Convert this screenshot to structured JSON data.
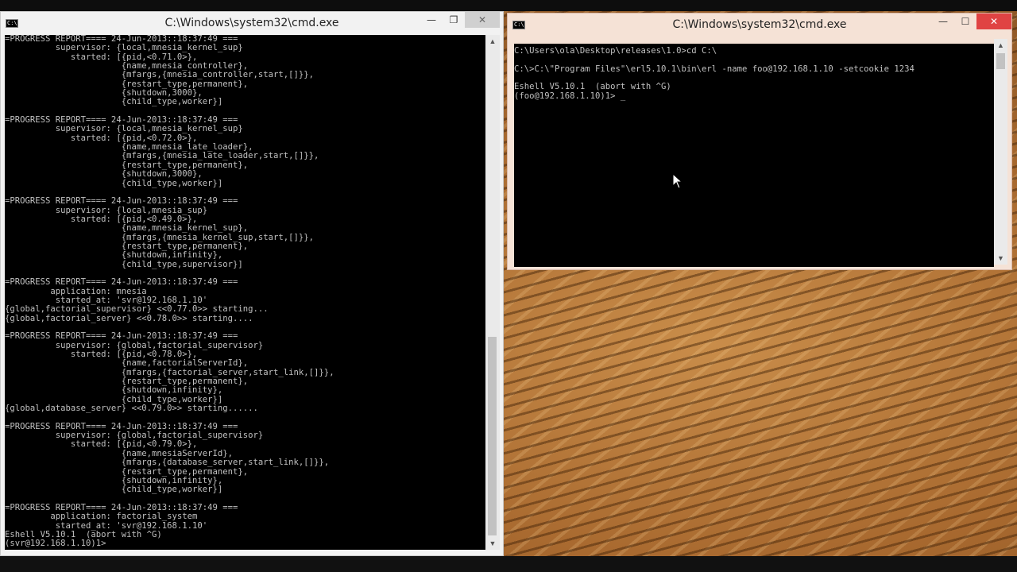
{
  "left_window": {
    "title": "C:\\Windows\\system32\\cmd.exe",
    "icon_label": "C:\\",
    "controls": {
      "minimize": "—",
      "maximize": "❐",
      "close": "✕"
    },
    "lines": [
      "=PROGRESS REPORT==== 24-Jun-2013::18:37:49 ===",
      "          supervisor: {local,mnesia_kernel_sup}",
      "             started: [{pid,<0.71.0>},",
      "                       {name,mnesia_controller},",
      "                       {mfargs,{mnesia_controller,start,[]}},",
      "                       {restart_type,permanent},",
      "                       {shutdown,3000},",
      "                       {child_type,worker}]",
      "",
      "=PROGRESS REPORT==== 24-Jun-2013::18:37:49 ===",
      "          supervisor: {local,mnesia_kernel_sup}",
      "             started: [{pid,<0.72.0>},",
      "                       {name,mnesia_late_loader},",
      "                       {mfargs,{mnesia_late_loader,start,[]}},",
      "                       {restart_type,permanent},",
      "                       {shutdown,3000},",
      "                       {child_type,worker}]",
      "",
      "=PROGRESS REPORT==== 24-Jun-2013::18:37:49 ===",
      "          supervisor: {local,mnesia_sup}",
      "             started: [{pid,<0.49.0>},",
      "                       {name,mnesia_kernel_sup},",
      "                       {mfargs,{mnesia_kernel_sup,start,[]}},",
      "                       {restart_type,permanent},",
      "                       {shutdown,infinity},",
      "                       {child_type,supervisor}]",
      "",
      "=PROGRESS REPORT==== 24-Jun-2013::18:37:49 ===",
      "         application: mnesia",
      "          started_at: 'svr@192.168.1.10'",
      "{global,factorial_supervisor} <<0.77.0>> starting...",
      "{global,factorial_server} <<0.78.0>> starting....",
      "",
      "=PROGRESS REPORT==== 24-Jun-2013::18:37:49 ===",
      "          supervisor: {global,factorial_supervisor}",
      "             started: [{pid,<0.78.0>},",
      "                       {name,factorialServerId},",
      "                       {mfargs,{factorial_server,start_link,[]}},",
      "                       {restart_type,permanent},",
      "                       {shutdown,infinity},",
      "                       {child_type,worker}]",
      "{global,database_server} <<0.79.0>> starting......",
      "",
      "=PROGRESS REPORT==== 24-Jun-2013::18:37:49 ===",
      "          supervisor: {global,factorial_supervisor}",
      "             started: [{pid,<0.79.0>},",
      "                       {name,mnesiaServerId},",
      "                       {mfargs,{database_server,start_link,[]}},",
      "                       {restart_type,permanent},",
      "                       {shutdown,infinity},",
      "                       {child_type,worker}]",
      "",
      "=PROGRESS REPORT==== 24-Jun-2013::18:37:49 ===",
      "         application: factorial_system",
      "          started_at: 'svr@192.168.1.10'",
      "Eshell V5.10.1  (abort with ^G)",
      "(svr@192.168.1.10)1>"
    ]
  },
  "right_window": {
    "title": "C:\\Windows\\system32\\cmd.exe",
    "icon_label": "C:\\",
    "controls": {
      "minimize": "—",
      "maximize": "☐",
      "close": "✕"
    },
    "lines": [
      "C:\\Users\\ola\\Desktop\\releases\\1.0>cd C:\\",
      "",
      "C:\\>C:\\\"Program Files\"\\erl5.10.1\\bin\\erl -name foo@192.168.1.10 -setcookie 1234",
      "",
      "Eshell V5.10.1  (abort with ^G)",
      "(foo@192.168.1.10)1> _"
    ]
  },
  "colors": {
    "console_bg": "#000000",
    "console_text": "#c0c0c0",
    "close_active": "#e04343"
  }
}
